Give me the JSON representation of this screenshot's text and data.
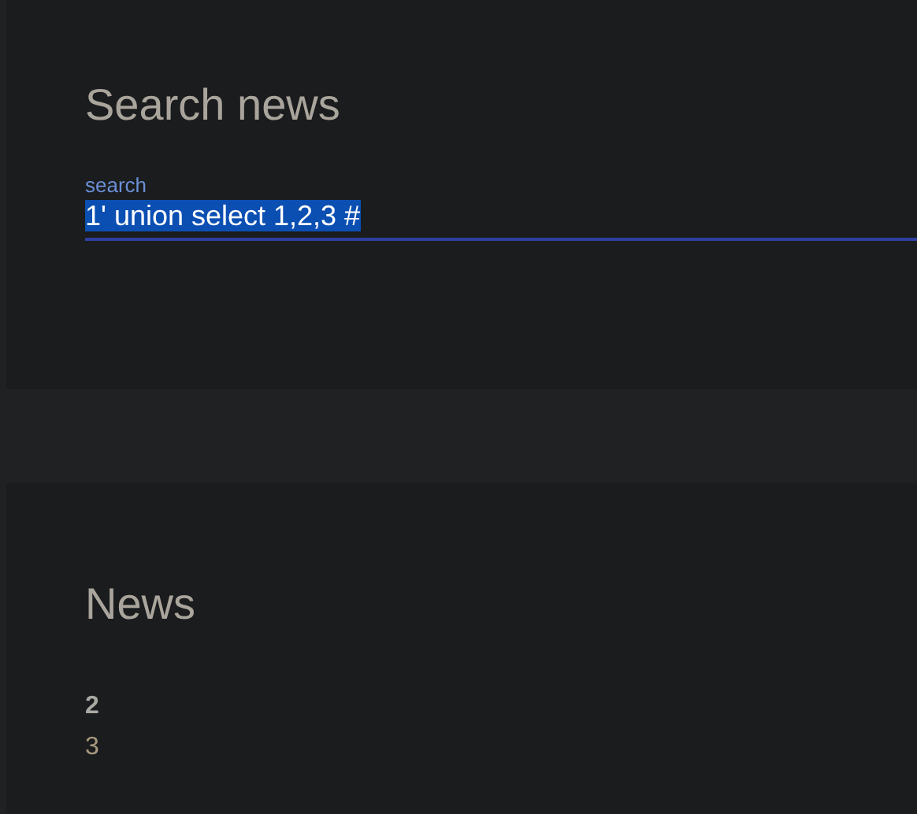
{
  "search_card": {
    "title": "Search news",
    "field": {
      "label": "search",
      "value": "1' union select 1,2,3 #",
      "value_selected": true
    }
  },
  "news_card": {
    "title": "News",
    "items": [
      {
        "text": "2",
        "bold": true
      },
      {
        "text": "3",
        "bold": false
      }
    ]
  }
}
